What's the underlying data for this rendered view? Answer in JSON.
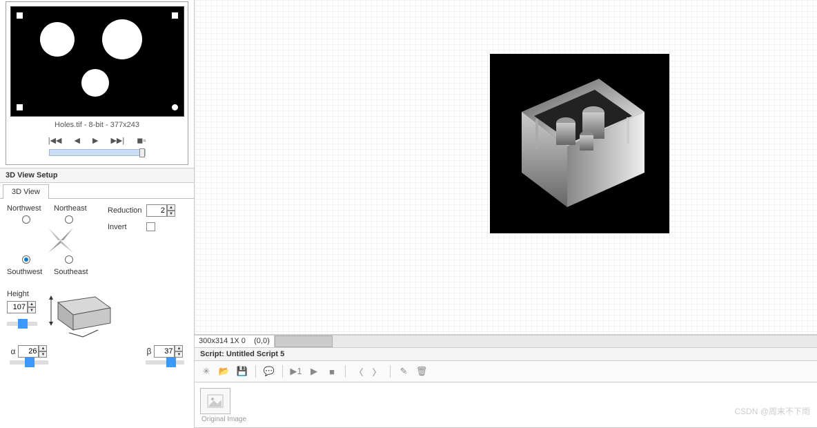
{
  "preview": {
    "caption": "Holes.tif - 8-bit - 377x243"
  },
  "section": {
    "title": "3D View Setup",
    "tab": "3D View"
  },
  "directions": {
    "nw": "Northwest",
    "ne": "Northeast",
    "sw": "Southwest",
    "se": "Southeast",
    "selected": "sw"
  },
  "options": {
    "reduction_label": "Reduction",
    "reduction_value": "2",
    "invert_label": "Invert"
  },
  "height": {
    "label": "Height",
    "value": "107"
  },
  "alpha": {
    "label": "α",
    "value": "26"
  },
  "beta": {
    "label": "β",
    "value": "37"
  },
  "status": {
    "info": "300x314 1X 0    (0,0)"
  },
  "script": {
    "title": "Script: Untitled Script 5"
  },
  "thumb": {
    "label": "Original Image"
  },
  "watermark": "CSDN @周末不下雨"
}
